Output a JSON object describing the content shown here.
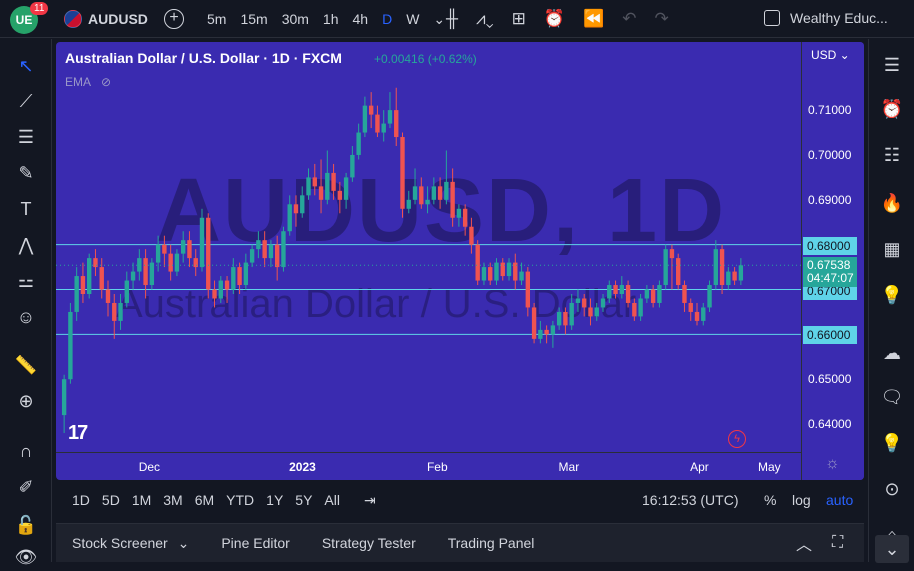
{
  "header": {
    "logo_text": "UE",
    "notifications": "11",
    "symbol": "AUDUSD",
    "intervals": [
      "5m",
      "15m",
      "30m",
      "1h",
      "4h",
      "D",
      "W"
    ],
    "active_interval": "D",
    "layout_name": "Wealthy Educ..."
  },
  "chart": {
    "title": "Australian Dollar / U.S. Dollar · 1D · FXCM",
    "change": "+0.00416 (+0.62%)",
    "indicator": "EMA",
    "watermark_symbol": "AUDUSD, 1D",
    "watermark_name": "Australian Dollar / U.S. Dollar",
    "currency": "USD",
    "last_price": "0.67538",
    "countdown": "04:47:07",
    "colors": {
      "background": "#3a2bb0",
      "up": "#26a69a",
      "down": "#ef5350",
      "hline": "#5fd3e8"
    },
    "price_ticks": [
      "0.71000",
      "0.70000",
      "0.69000",
      "0.68000",
      "0.67000",
      "0.66000",
      "0.65000",
      "0.64000"
    ],
    "hline_labels": [
      "0.68000",
      "0.67000",
      "0.66000"
    ],
    "time_ticks": [
      "Dec",
      "2023",
      "Feb",
      "Mar",
      "Apr",
      "May"
    ]
  },
  "chart_data": {
    "type": "candlestick",
    "title": "Australian Dollar / U.S. Dollar · 1D · FXCM",
    "ylim": [
      0.636,
      0.7185
    ],
    "horizontal_lines": [
      0.68,
      0.67,
      0.66
    ],
    "candles": [
      [
        0.642,
        0.65,
        0.638,
        0.651
      ],
      [
        0.65,
        0.665,
        0.649,
        0.667
      ],
      [
        0.665,
        0.673,
        0.663,
        0.675
      ],
      [
        0.673,
        0.669,
        0.667,
        0.676
      ],
      [
        0.669,
        0.677,
        0.668,
        0.678
      ],
      [
        0.677,
        0.675,
        0.673,
        0.679
      ],
      [
        0.675,
        0.67,
        0.668,
        0.677
      ],
      [
        0.67,
        0.667,
        0.664,
        0.672
      ],
      [
        0.667,
        0.663,
        0.659,
        0.669
      ],
      [
        0.663,
        0.667,
        0.661,
        0.669
      ],
      [
        0.667,
        0.672,
        0.666,
        0.674
      ],
      [
        0.672,
        0.674,
        0.67,
        0.676
      ],
      [
        0.674,
        0.677,
        0.672,
        0.679
      ],
      [
        0.677,
        0.671,
        0.668,
        0.679
      ],
      [
        0.671,
        0.676,
        0.67,
        0.677
      ],
      [
        0.676,
        0.68,
        0.674,
        0.682
      ],
      [
        0.68,
        0.678,
        0.675,
        0.682
      ],
      [
        0.678,
        0.674,
        0.672,
        0.68
      ],
      [
        0.674,
        0.678,
        0.673,
        0.679
      ],
      [
        0.678,
        0.681,
        0.676,
        0.683
      ],
      [
        0.681,
        0.677,
        0.675,
        0.683
      ],
      [
        0.677,
        0.675,
        0.673,
        0.679
      ],
      [
        0.675,
        0.686,
        0.674,
        0.688
      ],
      [
        0.686,
        0.67,
        0.668,
        0.687
      ],
      [
        0.67,
        0.668,
        0.666,
        0.672
      ],
      [
        0.668,
        0.672,
        0.667,
        0.673
      ],
      [
        0.672,
        0.67,
        0.667,
        0.673
      ],
      [
        0.67,
        0.675,
        0.669,
        0.677
      ],
      [
        0.675,
        0.671,
        0.669,
        0.676
      ],
      [
        0.671,
        0.676,
        0.67,
        0.678
      ],
      [
        0.676,
        0.679,
        0.675,
        0.68
      ],
      [
        0.679,
        0.681,
        0.677,
        0.683
      ],
      [
        0.681,
        0.677,
        0.675,
        0.683
      ],
      [
        0.677,
        0.68,
        0.675,
        0.681
      ],
      [
        0.68,
        0.675,
        0.672,
        0.682
      ],
      [
        0.675,
        0.683,
        0.674,
        0.684
      ],
      [
        0.683,
        0.689,
        0.682,
        0.691
      ],
      [
        0.689,
        0.687,
        0.684,
        0.691
      ],
      [
        0.687,
        0.691,
        0.686,
        0.693
      ],
      [
        0.691,
        0.695,
        0.69,
        0.697
      ],
      [
        0.695,
        0.693,
        0.691,
        0.698
      ],
      [
        0.693,
        0.69,
        0.687,
        0.699
      ],
      [
        0.69,
        0.696,
        0.689,
        0.701
      ],
      [
        0.696,
        0.692,
        0.69,
        0.698
      ],
      [
        0.692,
        0.69,
        0.687,
        0.694
      ],
      [
        0.69,
        0.695,
        0.688,
        0.696
      ],
      [
        0.695,
        0.7,
        0.694,
        0.702
      ],
      [
        0.7,
        0.705,
        0.699,
        0.707
      ],
      [
        0.705,
        0.711,
        0.704,
        0.713
      ],
      [
        0.711,
        0.709,
        0.706,
        0.714
      ],
      [
        0.709,
        0.705,
        0.704,
        0.711
      ],
      [
        0.705,
        0.707,
        0.703,
        0.71
      ],
      [
        0.707,
        0.71,
        0.706,
        0.714
      ],
      [
        0.71,
        0.704,
        0.702,
        0.715
      ],
      [
        0.704,
        0.688,
        0.686,
        0.705
      ],
      [
        0.688,
        0.69,
        0.687,
        0.692
      ],
      [
        0.69,
        0.693,
        0.689,
        0.697
      ],
      [
        0.693,
        0.689,
        0.688,
        0.695
      ],
      [
        0.689,
        0.69,
        0.687,
        0.693
      ],
      [
        0.69,
        0.693,
        0.689,
        0.695
      ],
      [
        0.693,
        0.69,
        0.688,
        0.695
      ],
      [
        0.69,
        0.694,
        0.689,
        0.701
      ],
      [
        0.694,
        0.686,
        0.684,
        0.697
      ],
      [
        0.686,
        0.688,
        0.684,
        0.689
      ],
      [
        0.688,
        0.684,
        0.682,
        0.689
      ],
      [
        0.684,
        0.68,
        0.678,
        0.686
      ],
      [
        0.68,
        0.672,
        0.671,
        0.681
      ],
      [
        0.672,
        0.675,
        0.671,
        0.676
      ],
      [
        0.675,
        0.672,
        0.671,
        0.676
      ],
      [
        0.672,
        0.676,
        0.671,
        0.677
      ],
      [
        0.676,
        0.673,
        0.672,
        0.677
      ],
      [
        0.673,
        0.676,
        0.672,
        0.677
      ],
      [
        0.676,
        0.672,
        0.67,
        0.678
      ],
      [
        0.672,
        0.674,
        0.671,
        0.676
      ],
      [
        0.674,
        0.666,
        0.664,
        0.675
      ],
      [
        0.666,
        0.659,
        0.658,
        0.667
      ],
      [
        0.659,
        0.661,
        0.658,
        0.663
      ],
      [
        0.661,
        0.66,
        0.658,
        0.662
      ],
      [
        0.66,
        0.662,
        0.657,
        0.663
      ],
      [
        0.662,
        0.665,
        0.661,
        0.666
      ],
      [
        0.665,
        0.662,
        0.66,
        0.666
      ],
      [
        0.662,
        0.667,
        0.661,
        0.669
      ],
      [
        0.667,
        0.668,
        0.665,
        0.67
      ],
      [
        0.668,
        0.666,
        0.664,
        0.669
      ],
      [
        0.666,
        0.664,
        0.662,
        0.668
      ],
      [
        0.664,
        0.666,
        0.663,
        0.667
      ],
      [
        0.666,
        0.668,
        0.665,
        0.669
      ],
      [
        0.668,
        0.671,
        0.667,
        0.672
      ],
      [
        0.671,
        0.669,
        0.668,
        0.672
      ],
      [
        0.669,
        0.671,
        0.668,
        0.673
      ],
      [
        0.671,
        0.667,
        0.666,
        0.672
      ],
      [
        0.667,
        0.664,
        0.663,
        0.668
      ],
      [
        0.664,
        0.668,
        0.663,
        0.669
      ],
      [
        0.668,
        0.67,
        0.667,
        0.671
      ],
      [
        0.67,
        0.667,
        0.666,
        0.671
      ],
      [
        0.667,
        0.671,
        0.666,
        0.672
      ],
      [
        0.671,
        0.679,
        0.67,
        0.68
      ],
      [
        0.679,
        0.677,
        0.67,
        0.68
      ],
      [
        0.677,
        0.671,
        0.67,
        0.678
      ],
      [
        0.671,
        0.667,
        0.665,
        0.672
      ],
      [
        0.667,
        0.665,
        0.663,
        0.668
      ],
      [
        0.665,
        0.663,
        0.662,
        0.667
      ],
      [
        0.663,
        0.666,
        0.662,
        0.667
      ],
      [
        0.666,
        0.671,
        0.665,
        0.672
      ],
      [
        0.671,
        0.679,
        0.67,
        0.681
      ],
      [
        0.679,
        0.671,
        0.669,
        0.68
      ],
      [
        0.671,
        0.674,
        0.67,
        0.675
      ],
      [
        0.674,
        0.672,
        0.671,
        0.675
      ],
      [
        0.672,
        0.6754,
        0.671,
        0.677
      ]
    ]
  },
  "rangebar": {
    "ranges": [
      "1D",
      "5D",
      "1M",
      "3M",
      "6M",
      "YTD",
      "1Y",
      "5Y",
      "All"
    ],
    "clock": "16:12:53 (UTC)",
    "percent": "%",
    "log": "log",
    "auto": "auto"
  },
  "bottom_panel": {
    "tabs": [
      "Stock Screener",
      "Pine Editor",
      "Strategy Tester",
      "Trading Panel"
    ]
  },
  "icons": {
    "left": [
      "cursor-icon",
      "trendline-icon",
      "fib-icon",
      "brush-icon",
      "text-icon",
      "pattern-icon",
      "prediction-icon",
      "emoji-icon",
      "ruler-icon",
      "zoom-icon",
      "magnet-icon",
      "lock-drawing-icon",
      "lock-icon",
      "eye-icon"
    ],
    "right": [
      "watchlist-icon",
      "alarm-icon",
      "news-icon",
      "hotlist-icon",
      "calendar-icon",
      "ideas-icon",
      "streams-icon",
      "chat-icon",
      "notifications-icon",
      "playback-icon",
      "drop-icon"
    ]
  }
}
